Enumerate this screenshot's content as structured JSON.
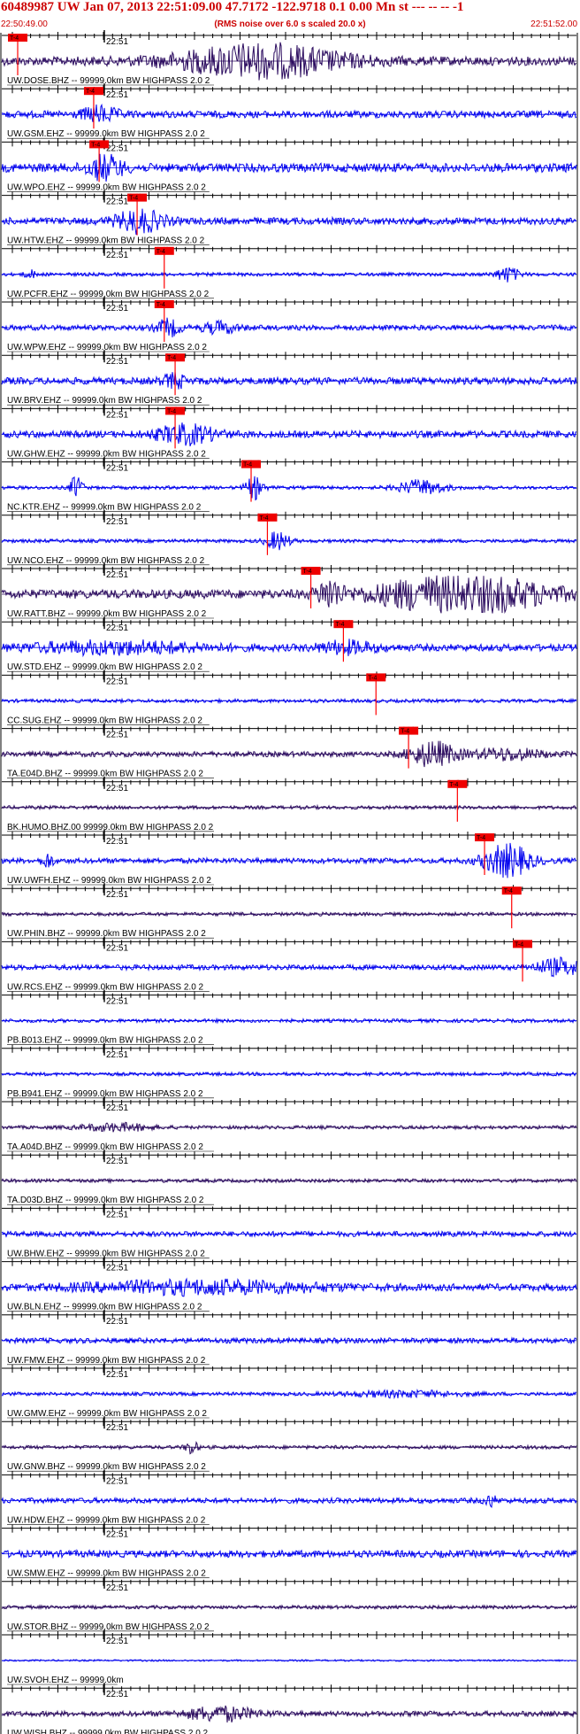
{
  "header": {
    "title": "60489987 UW Jan 07, 2013 22:51:09.00   47.7172 -122.9718  0.1 0.00 Mn st --- -- --   -1",
    "start_time": "22:50:49.00",
    "noise_note": "(RMS noise over 6.0 s scaled 20.0 x)",
    "end_time": "22:51:52.00"
  },
  "colors": {
    "header_text": "#cc0000",
    "trace_blue": "#0000ee",
    "trace_dark": "#2a0a5e",
    "pick_red": "#ff0000",
    "pick_box": "#ee0000",
    "axis": "#000000"
  },
  "time_mark": "22:51",
  "pick_label": "T-4",
  "traces": [
    {
      "label": "UW.DOSE.BHZ -- 99999.0km BW  HIGHPASS  2.0  2",
      "color": "dark",
      "pick": 0.0,
      "amp": 5,
      "bursts": [
        [
          0.45,
          0.14,
          3.5
        ]
      ]
    },
    {
      "label": "UW.GSM.EHZ -- 99999.0km BW  HIGHPASS  2.0  2",
      "color": "blue",
      "pick": 0.14,
      "amp": 4,
      "bursts": [
        [
          0.17,
          0.03,
          2.0
        ]
      ]
    },
    {
      "label": "UW.WPO.EHZ -- 99999.0km BW  HIGHPASS  2.0  2",
      "color": "blue",
      "pick": 0.15,
      "amp": 5,
      "bursts": [
        [
          0.18,
          0.03,
          2.5
        ]
      ]
    },
    {
      "label": "UW.HTW.EHZ -- 99999.0km BW  HIGHPASS  2.0  2",
      "color": "blue",
      "pick": 0.22,
      "amp": 4,
      "bursts": [
        [
          0.24,
          0.04,
          3.0
        ]
      ]
    },
    {
      "label": "UW.PCFR.EHZ -- 99999.0km BW  HIGHPASS  2.0  2",
      "color": "blue",
      "pick": 0.27,
      "amp": 2,
      "bursts": [
        [
          0.88,
          0.02,
          4.0
        ],
        [
          0.05,
          0.01,
          2.0
        ]
      ]
    },
    {
      "label": "UW.WPW.EHZ -- 99999.0km BW  HIGHPASS  2.0  2",
      "color": "blue",
      "pick": 0.27,
      "amp": 3,
      "bursts": [
        [
          0.29,
          0.02,
          3.0
        ],
        [
          0.38,
          0.03,
          2.0
        ]
      ]
    },
    {
      "label": "UW.BRV.EHZ -- 99999.0km BW  HIGHPASS  2.0  2",
      "color": "blue",
      "pick": 0.29,
      "amp": 4,
      "bursts": [
        [
          0.3,
          0.02,
          1.8
        ]
      ]
    },
    {
      "label": "UW.GHW.EHZ -- 99999.0km BW  HIGHPASS  2.0  2",
      "color": "blue",
      "pick": 0.29,
      "amp": 4,
      "bursts": [
        [
          0.32,
          0.05,
          2.5
        ]
      ]
    },
    {
      "label": "NC.KTR.EHZ -- 99999.0km BW  HIGHPASS  2.0  2",
      "color": "blue",
      "pick": 0.43,
      "amp": 2,
      "bursts": [
        [
          0.13,
          0.01,
          7.0
        ],
        [
          0.44,
          0.015,
          6.0
        ],
        [
          0.73,
          0.04,
          4.0
        ]
      ]
    },
    {
      "label": "UW.NCO.EHZ -- 99999.0km BW  HIGHPASS  2.0  2",
      "color": "blue",
      "pick": 0.46,
      "amp": 2,
      "bursts": [
        [
          0.48,
          0.02,
          5.0
        ]
      ]
    },
    {
      "label": "UW.RATT.BHZ -- 99999.0km BW  HIGHPASS  2.0  2",
      "color": "dark",
      "pick": 0.54,
      "amp": 5,
      "bursts": [
        [
          0.57,
          0.02,
          3.0
        ],
        [
          0.8,
          0.14,
          4.5
        ]
      ]
    },
    {
      "label": "UW.STD.EHZ -- 99999.0km BW  HIGHPASS  2.0  2",
      "color": "blue",
      "pick": 0.6,
      "amp": 4,
      "bursts": [
        [
          0.2,
          0.15,
          1.5
        ],
        [
          0.6,
          0.05,
          1.5
        ]
      ]
    },
    {
      "label": "CC.SUG.EHZ -- 99999.0km BW  HIGHPASS  2.0  2",
      "color": "blue",
      "pick": 0.66,
      "amp": 2,
      "bursts": []
    },
    {
      "label": "TA.E04D.BHZ -- 99999.0km BW  HIGHPASS  2.0  2",
      "color": "dark",
      "pick": 0.72,
      "amp": 3,
      "bursts": [
        [
          0.75,
          0.04,
          4.5
        ],
        [
          0.88,
          0.06,
          2.0
        ]
      ]
    },
    {
      "label": "BK.HUMO.BHZ.00 99999.0km BW  HIGHPASS  2.0  2",
      "color": "dark",
      "pick": 0.81,
      "amp": 2,
      "bursts": []
    },
    {
      "label": "UW.UWFH.EHZ -- 99999.0km BW  HIGHPASS  2.0  2",
      "color": "blue",
      "pick": 0.86,
      "amp": 3,
      "bursts": [
        [
          0.88,
          0.04,
          6.0
        ],
        [
          0.08,
          0.01,
          2.5
        ]
      ]
    },
    {
      "label": "UW.PHIN.BHZ -- 99999.0km BW  HIGHPASS  2.0  2",
      "color": "dark",
      "pick": 0.91,
      "amp": 2,
      "bursts": []
    },
    {
      "label": "UW.RCS.EHZ -- 99999.0km BW  HIGHPASS  2.0  2",
      "color": "blue",
      "pick": 0.93,
      "amp": 3,
      "bursts": [
        [
          0.97,
          0.04,
          3.0
        ]
      ]
    },
    {
      "label": "PB.B013.EHZ -- 99999.0km BW  HIGHPASS  2.0  2",
      "color": "blue",
      "pick": null,
      "amp": 2,
      "bursts": []
    },
    {
      "label": "PB.B941.EHZ -- 99999.0km BW  HIGHPASS  2.0  2",
      "color": "blue",
      "pick": null,
      "amp": 2,
      "bursts": []
    },
    {
      "label": "TA.A04D.BHZ -- 99999.0km BW  HIGHPASS  2.0  2",
      "color": "dark",
      "pick": null,
      "amp": 2,
      "bursts": [
        [
          0.2,
          0.06,
          2.0
        ]
      ]
    },
    {
      "label": "TA.D03D.BHZ -- 99999.0km BW  HIGHPASS  2.0  2",
      "color": "dark",
      "pick": null,
      "amp": 2,
      "bursts": []
    },
    {
      "label": "UW.BHW.EHZ -- 99999.0km BW  HIGHPASS  2.0  2",
      "color": "blue",
      "pick": null,
      "amp": 3,
      "bursts": []
    },
    {
      "label": "UW.BLN.EHZ -- 99999.0km BW  HIGHPASS  2.0  2",
      "color": "blue",
      "pick": null,
      "amp": 4,
      "bursts": [
        [
          0.35,
          0.2,
          1.6
        ]
      ]
    },
    {
      "label": "UW.FMW.EHZ -- 99999.0km BW  HIGHPASS  2.0  2",
      "color": "blue",
      "pick": null,
      "amp": 3,
      "bursts": []
    },
    {
      "label": "UW.GMW.EHZ -- 99999.0km BW  HIGHPASS  2.0  2",
      "color": "blue",
      "pick": null,
      "amp": 2,
      "bursts": [
        [
          0.7,
          0.1,
          1.5
        ]
      ]
    },
    {
      "label": "UW.GNW.BHZ -- 99999.0km BW  HIGHPASS  2.0  2",
      "color": "dark",
      "pick": null,
      "amp": 2,
      "bursts": [
        [
          0.33,
          0.01,
          4.0
        ]
      ]
    },
    {
      "label": "UW.HDW.EHZ -- 99999.0km BW  HIGHPASS  2.0  2",
      "color": "blue",
      "pick": null,
      "amp": 3,
      "bursts": [
        [
          0.85,
          0.01,
          2.0
        ]
      ]
    },
    {
      "label": "UW.SMW.EHZ -- 99999.0km BW  HIGHPASS  2.0  2",
      "color": "blue",
      "pick": null,
      "amp": 4,
      "bursts": []
    },
    {
      "label": "UW.STOR.BHZ -- 99999.0km BW  HIGHPASS  2.0  2",
      "color": "dark",
      "pick": null,
      "amp": 2,
      "bursts": []
    },
    {
      "label": "UW.SVOH.EHZ -- 99999.0km",
      "color": "blue",
      "pick": null,
      "amp": 1,
      "bursts": []
    },
    {
      "label": "UW.WISH.BHZ -- 99999.0km BW  HIGHPASS  2.0  2",
      "color": "dark",
      "pick": null,
      "amp": 3,
      "bursts": [
        [
          0.38,
          0.06,
          2.5
        ]
      ]
    }
  ]
}
